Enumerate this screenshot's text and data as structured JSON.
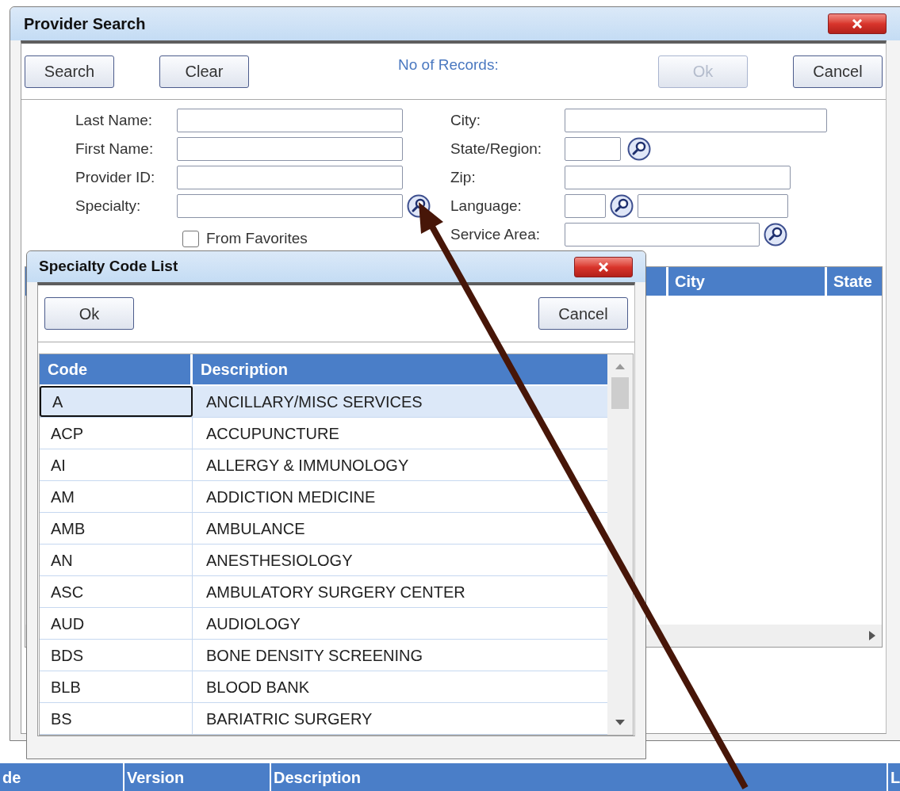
{
  "background_table": {
    "columns": [
      "de",
      "Version",
      "Description",
      "L"
    ]
  },
  "provider_search": {
    "title": "Provider Search",
    "buttons": [
      {
        "label": "Search",
        "disabled": false
      },
      {
        "label": "Clear",
        "disabled": false
      }
    ],
    "records_label": "No of Records:",
    "actions": [
      {
        "label": "Ok",
        "disabled": true
      },
      {
        "label": "Cancel",
        "disabled": false
      }
    ],
    "left_fields": [
      {
        "label": "Last Name:",
        "kind": "text"
      },
      {
        "label": "First Name:",
        "kind": "text"
      },
      {
        "label": "Provider ID:",
        "kind": "text"
      },
      {
        "label": "Specialty:",
        "kind": "lookup"
      }
    ],
    "from_favorites": {
      "label": "From Favorites",
      "checked": false
    },
    "right_fields": [
      {
        "label": "City:",
        "kind": "wide"
      },
      {
        "label": "State/Region:",
        "kind": "code_lookup"
      },
      {
        "label": "Zip:",
        "kind": "medium"
      },
      {
        "label": "Language:",
        "kind": "code_lookup_text"
      },
      {
        "label": "Service Area:",
        "kind": "medium_lookup"
      }
    ],
    "results": {
      "columns": [
        "City",
        "State"
      ]
    }
  },
  "specialty_dialog": {
    "title": "Specialty Code List",
    "buttons": [
      {
        "label": "Ok"
      },
      {
        "label": "Cancel"
      }
    ],
    "columns": [
      "Code",
      "Description"
    ],
    "rows": [
      {
        "code": "A",
        "description": "ANCILLARY/MISC SERVICES",
        "selected": true
      },
      {
        "code": "ACP",
        "description": "ACCUPUNCTURE",
        "selected": false
      },
      {
        "code": "AI",
        "description": "ALLERGY & IMMUNOLOGY",
        "selected": false
      },
      {
        "code": "AM",
        "description": "ADDICTION MEDICINE",
        "selected": false
      },
      {
        "code": "AMB",
        "description": "AMBULANCE",
        "selected": false
      },
      {
        "code": "AN",
        "description": "ANESTHESIOLOGY",
        "selected": false
      },
      {
        "code": "ASC",
        "description": "AMBULATORY SURGERY CENTER",
        "selected": false
      },
      {
        "code": "AUD",
        "description": "AUDIOLOGY",
        "selected": false
      },
      {
        "code": "BDS",
        "description": "BONE DENSITY SCREENING",
        "selected": false
      },
      {
        "code": "BLB",
        "description": "BLOOD BANK",
        "selected": false
      },
      {
        "code": "BS",
        "description": "BARIATRIC SURGERY",
        "selected": false
      }
    ]
  }
}
